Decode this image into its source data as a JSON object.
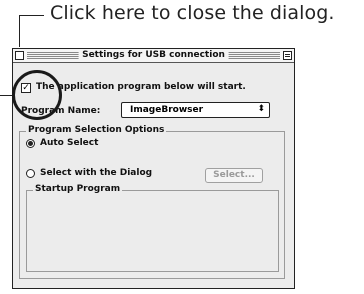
{
  "callout": {
    "text": "Click here to close the dialog."
  },
  "window": {
    "title": "Settings for USB connection"
  },
  "start_checkbox": {
    "checked": true,
    "label": "The application program below will start."
  },
  "program_name": {
    "label": "Program Name:",
    "value": "ImageBrowser",
    "arrow": "⬍"
  },
  "selection_options": {
    "label": "Program Selection Options",
    "auto": {
      "label": "Auto Select",
      "selected": true
    },
    "dialog": {
      "label": "Select with the Dialog",
      "selected": false
    },
    "select_button": "Select..."
  },
  "startup_program": {
    "label": "Startup Program"
  },
  "icons": {
    "check": "✓"
  }
}
